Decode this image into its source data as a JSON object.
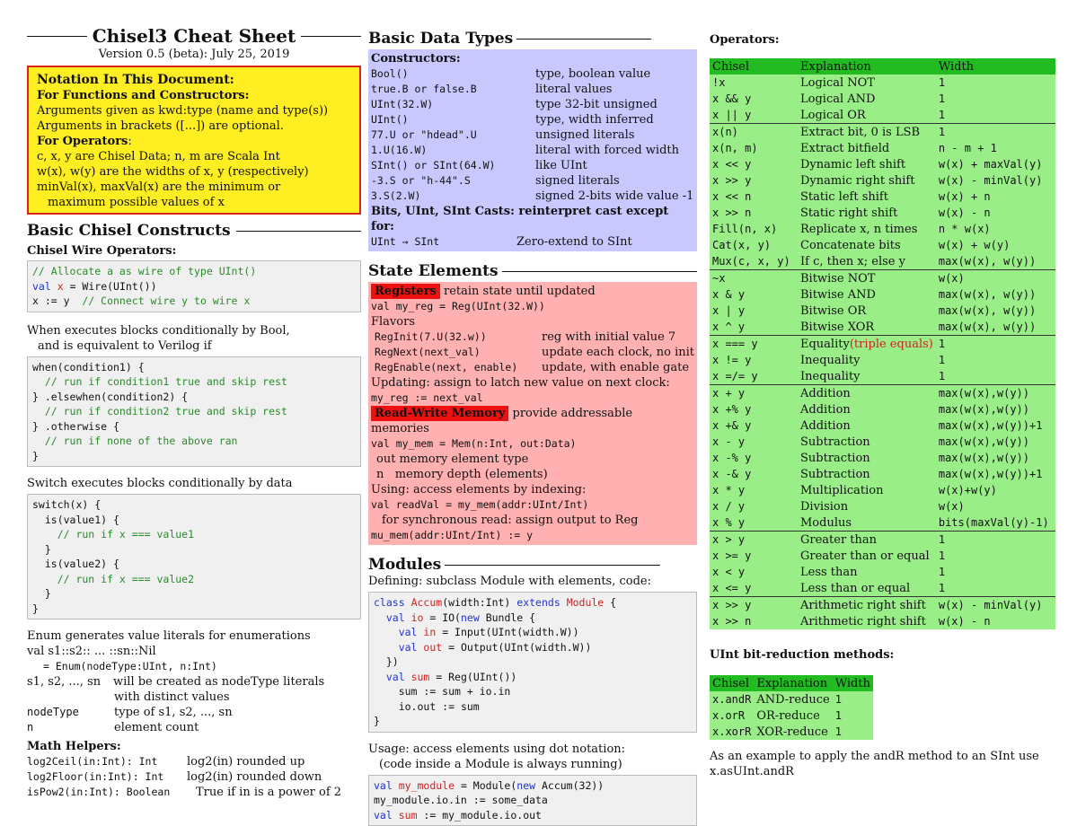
{
  "header": {
    "title": "Chisel3 Cheat Sheet",
    "version": "Version 0.5 (beta): July 25, 2019"
  },
  "notation": {
    "title": "Notation In This Document",
    "functions_heading": "For Functions and Constructors",
    "arg1": "Arguments given as kwd:type (name and type(s))",
    "arg2": "Arguments in brackets ([...]) are optional.",
    "operators_heading": "For Operators",
    "op1": "c, x, y are Chisel Data; n, m are Scala Int",
    "op2": "w(x), w(y) are the widths of x, y (respectively)",
    "op3": "minVal(x), maxVal(x) are the minimum or",
    "op4": "maximum possible values of x"
  },
  "basic_constructs": {
    "heading": "Basic Chisel Constructs",
    "wire_title": "Chisel Wire Operators:",
    "wire_code": [
      "// Allocate a as wire of type UInt()",
      "val x = Wire(UInt())",
      "x := y  // Connect wire y to wire x"
    ],
    "when_desc1": "When executes blocks conditionally by Bool,",
    "when_desc2": "and is equivalent to Verilog if",
    "when_code": [
      "when(condition1) {",
      "  // run if condition1 true and skip rest",
      "} .elsewhen(condition2) {",
      "  // run if condition2 true and skip rest",
      "} .otherwise {",
      "  // run if none of the above ran",
      "}"
    ],
    "switch_desc": "Switch executes blocks conditionally by data",
    "switch_code": [
      "switch(x) {",
      "  is(value1) {",
      "    // run if x === value1",
      "  }",
      "  is(value2) {",
      "    // run if x === value2",
      "  }",
      "}"
    ],
    "enum_desc": "Enum generates value literals for enumerations",
    "enum_l1": "val s1::s2:: ... ::sn::Nil",
    "enum_l2": "= Enum(nodeType:UInt, n:Int)",
    "enum_l3a": "s1, s2, ..., sn",
    "enum_l3b": "will be created as nodeType literals",
    "enum_l4": "with distinct values",
    "enum_l5a": "nodeType",
    "enum_l5b": "type of s1, s2, ..., sn",
    "enum_l6a": "n",
    "enum_l6b": "element count",
    "math_title": "Math Helpers:",
    "math": [
      {
        "code": "log2Ceil(in:Int): Int",
        "desc": "log2(in) rounded up"
      },
      {
        "code": "log2Floor(in:Int): Int",
        "desc": "log2(in) rounded down"
      },
      {
        "code": "isPow2(in:Int): Boolean",
        "desc": "True if in is a power of 2"
      }
    ]
  },
  "data_types": {
    "heading": "Basic Data Types",
    "constructors_label": "Constructors:",
    "rows": [
      {
        "code": "Bool()",
        "desc": "type, boolean value"
      },
      {
        "code": "true.B or false.B",
        "desc": "literal values"
      },
      {
        "code": "UInt(32.W)",
        "desc": "type 32-bit unsigned"
      },
      {
        "code": "UInt()",
        "desc": "type, width inferred"
      },
      {
        "code": "77.U or \"hdead\".U",
        "desc": "unsigned literals"
      },
      {
        "code": "1.U(16.W)",
        "desc": "literal with forced width"
      },
      {
        "code": "SInt() or SInt(64.W)",
        "desc": "like UInt"
      },
      {
        "code": "-3.S or \"h-44\".S",
        "desc": "signed literals"
      },
      {
        "code": "3.S(2.W)",
        "desc": "signed 2-bits wide value -1"
      }
    ],
    "casts_label": "Bits, UInt, SInt Casts: reinterpret cast except for:",
    "cast_code": "UInt → SInt",
    "cast_desc": "Zero-extend to SInt"
  },
  "state": {
    "heading": "State Elements",
    "registers_tag": "Registers",
    "registers_desc": "retain state until updated",
    "reg_code": "val my_reg = Reg(UInt(32.W))",
    "flavors": "Flavors",
    "flavor_rows": [
      {
        "code": "RegInit(7.U(32.w))",
        "desc": "reg with initial value 7"
      },
      {
        "code": "RegNext(next_val)",
        "desc": "update each clock, no init"
      },
      {
        "code": "RegEnable(next, enable)",
        "desc": "update, with enable gate"
      }
    ],
    "updating": "Updating: assign to latch new value on next clock:",
    "update_code": "my_reg := next_val",
    "rwm_tag": "Read-Write Memory",
    "rwm_desc": "provide addressable memories",
    "mem_code": "val my_mem = Mem(n:Int, out:Data)",
    "mem_out": "out memory element type",
    "mem_n": "n   memory depth (elements)",
    "using": "Using: access elements by indexing:",
    "read_code": "val readVal = my_mem(addr:UInt/Int)",
    "sync_note": "for synchronous read: assign output to Reg",
    "write_code": "mu_mem(addr:UInt/Int) := y"
  },
  "modules": {
    "heading": "Modules",
    "defining": "Defining: subclass Module with elements, code:",
    "code": [
      "class Accum(width:Int) extends Module {",
      "  val io = IO(new Bundle {",
      "    val in = Input(UInt(width.W))",
      "    val out = Output(UInt(width.W))",
      "  })",
      "  val sum = Reg(UInt())",
      "  sum := sum + io.in",
      "  io.out := sum",
      "}"
    ],
    "usage1": "Usage: access elements using dot notation:",
    "usage2": "(code inside a Module is always running)",
    "usage_code": [
      "val my_module = Module(new Accum(32))",
      "my_module.io.in := some_data",
      "val sum := my_module.io.out"
    ]
  },
  "operators": {
    "heading": "Operators:",
    "columns": [
      "Chisel",
      "Explanation",
      "Width"
    ],
    "rows": [
      {
        "c": "!x",
        "e": "Logical NOT",
        "w": "1",
        "s": 0
      },
      {
        "c": "x && y",
        "e": "Logical AND",
        "w": "1",
        "s": 0
      },
      {
        "c": "x || y",
        "e": "Logical OR",
        "w": "1",
        "s": 0
      },
      {
        "c": "x(n)",
        "e": "Extract bit, 0 is LSB",
        "w": "1",
        "s": 1
      },
      {
        "c": "x(n, m)",
        "e": "Extract bitfield",
        "w": "n - m + 1",
        "s": 0
      },
      {
        "c": "x << y",
        "e": "Dynamic left shift",
        "w": "w(x) + maxVal(y)",
        "s": 0
      },
      {
        "c": "x >> y",
        "e": "Dynamic right shift",
        "w": "w(x) - minVal(y)",
        "s": 0
      },
      {
        "c": "x << n",
        "e": "Static left shift",
        "w": "w(x) + n",
        "s": 0
      },
      {
        "c": "x >> n",
        "e": "Static right shift",
        "w": "w(x) - n",
        "s": 0
      },
      {
        "c": "Fill(n, x)",
        "e": "Replicate x, n times",
        "w": "n * w(x)",
        "s": 0
      },
      {
        "c": "Cat(x, y)",
        "e": "Concatenate bits",
        "w": "w(x) + w(y)",
        "s": 0
      },
      {
        "c": "Mux(c, x, y)",
        "e": "If c, then x; else y",
        "w": "max(w(x), w(y))",
        "s": 0
      },
      {
        "c": "~x",
        "e": "Bitwise NOT",
        "w": "w(x)",
        "s": 1
      },
      {
        "c": "x & y",
        "e": "Bitwise AND",
        "w": "max(w(x), w(y))",
        "s": 0
      },
      {
        "c": "x | y",
        "e": "Bitwise OR",
        "w": "max(w(x), w(y))",
        "s": 0
      },
      {
        "c": "x ^ y",
        "e": "Bitwise XOR",
        "w": "max(w(x), w(y))",
        "s": 0
      },
      {
        "c": "x === y",
        "e": "Equality",
        "note": "(triple equals)",
        "w": "1",
        "s": 1
      },
      {
        "c": "x != y",
        "e": "Inequality",
        "w": "1",
        "s": 0
      },
      {
        "c": "x =/= y",
        "e": "Inequality",
        "w": "1",
        "s": 0
      },
      {
        "c": "x + y",
        "e": "Addition",
        "w": "max(w(x),w(y))",
        "s": 1
      },
      {
        "c": "x +% y",
        "e": "Addition",
        "w": "max(w(x),w(y))",
        "s": 0
      },
      {
        "c": "x +& y",
        "e": "Addition",
        "w": "max(w(x),w(y))+1",
        "s": 0
      },
      {
        "c": "x - y",
        "e": "Subtraction",
        "w": "max(w(x),w(y))",
        "s": 0
      },
      {
        "c": "x -% y",
        "e": "Subtraction",
        "w": "max(w(x),w(y))",
        "s": 0
      },
      {
        "c": "x -& y",
        "e": "Subtraction",
        "w": "max(w(x),w(y))+1",
        "s": 0
      },
      {
        "c": "x * y",
        "e": "Multiplication",
        "w": "w(x)+w(y)",
        "s": 0
      },
      {
        "c": "x / y",
        "e": "Division",
        "w": "w(x)",
        "s": 0
      },
      {
        "c": "x % y",
        "e": "Modulus",
        "w": "bits(maxVal(y)-1)",
        "s": 0
      },
      {
        "c": "x > y",
        "e": "Greater than",
        "w": "1",
        "s": 1
      },
      {
        "c": "x >= y",
        "e": "Greater than or equal",
        "w": "1",
        "s": 0
      },
      {
        "c": "x < y",
        "e": "Less than",
        "w": "1",
        "s": 0
      },
      {
        "c": "x <= y",
        "e": "Less than or equal",
        "w": "1",
        "s": 0
      },
      {
        "c": "x >> y",
        "e": "Arithmetic right shift",
        "w": "w(x) - minVal(y)",
        "s": 1
      },
      {
        "c": "x >> n",
        "e": "Arithmetic right shift",
        "w": "w(x) - n",
        "s": 0
      }
    ]
  },
  "reduction": {
    "heading": "UInt bit-reduction methods:",
    "columns": [
      "Chisel",
      "Explanation",
      "Width"
    ],
    "rows": [
      {
        "c": "x.andR",
        "e": "AND-reduce",
        "w": "1"
      },
      {
        "c": "x.orR",
        "e": "OR-reduce",
        "w": "1"
      },
      {
        "c": "x.xorR",
        "e": "XOR-reduce",
        "w": "1"
      }
    ],
    "example1": "As an example to apply the andR method to an SInt use",
    "example2": "x.asUInt.andR"
  },
  "colors": {
    "header_green": "#22bb22",
    "light_green": "#99ee88",
    "blue_box": "#c8c8ff",
    "pink_box": "#ffb0b0",
    "yellow_box": "#ffee22",
    "red_tag": "#ee1111",
    "comment_green": "#2a8a2a",
    "keyword_blue": "#2233cc",
    "ident_red": "#cc2222"
  }
}
